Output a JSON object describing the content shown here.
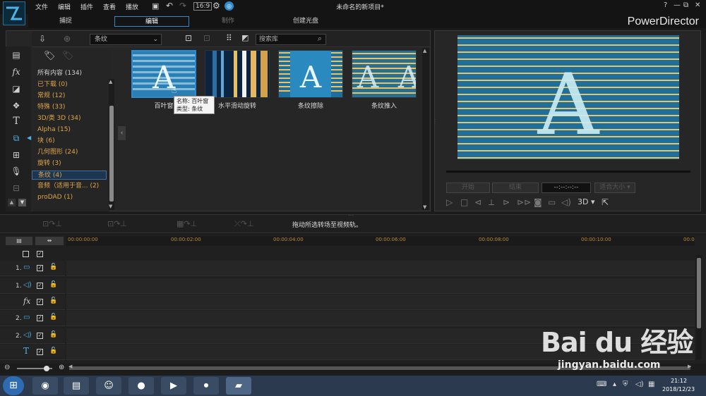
{
  "menu": {
    "items": [
      "文件",
      "编辑",
      "插件",
      "查看",
      "播放"
    ],
    "window_title": "未命名的新项目*",
    "window_buttons": [
      "?",
      "—",
      "⧉",
      "✕"
    ]
  },
  "tabs": [
    {
      "label": "捕捉"
    },
    {
      "label": "编辑"
    },
    {
      "label": "制作"
    },
    {
      "label": "创建光盘"
    }
  ],
  "brand": "PowerDirector",
  "library": {
    "filter": "条纹",
    "search_placeholder": "搜索库",
    "categories": [
      "所有内容 (134)",
      "已下载  (0)",
      "常规  (12)",
      "特殊  (33)",
      "3D/类 3D  (34)",
      "Alpha  (15)",
      "块  (6)",
      "几何图形  (24)",
      "旋转  (3)",
      "条纹  (4)",
      "音频（适用于音...  (2)",
      "proDAD  (1)"
    ],
    "selected_category": 9,
    "items": [
      {
        "label": "百叶窗",
        "letter": "A"
      },
      {
        "label": "水平滑动旋转",
        "letter": ""
      },
      {
        "label": "条纹擦除",
        "letter": "A"
      },
      {
        "label": "条纹推入",
        "letter": "A"
      }
    ],
    "tooltip": {
      "name": "名称: 百叶窗",
      "type": "类型: 条纹"
    }
  },
  "preview": {
    "mark_in": "开始",
    "mark_out": "结束",
    "timecode": "--:--:--:--",
    "size": "适合大小",
    "mode_3d": "3D"
  },
  "fx_bar": {
    "hint": "拖动所选转场至视频轨。"
  },
  "timeline": {
    "ruler": [
      "00:00:00:00",
      "00:00:02:00",
      "00:00:04:00",
      "00:00:06:00",
      "00:00:08:00",
      "00:00:10:00",
      "00:0"
    ],
    "tracks": [
      {
        "label": "1.",
        "kind": "video"
      },
      {
        "label": "1.",
        "kind": "audio"
      },
      {
        "label": "",
        "kind": "fx"
      },
      {
        "label": "2.",
        "kind": "video"
      },
      {
        "label": "2.",
        "kind": "audio"
      },
      {
        "label": "",
        "kind": "title"
      }
    ]
  },
  "taskbar": {
    "time": "21:12",
    "date": "2018/12/23"
  },
  "watermark": {
    "brand": "Bai du 经验",
    "url": "jingyan.baidu.com"
  },
  "colors": {
    "accent": "#2f8bd0",
    "category_text": "#e0a64a",
    "preview_bg": "#1f6f9a",
    "stripe": "#e6c56a"
  }
}
